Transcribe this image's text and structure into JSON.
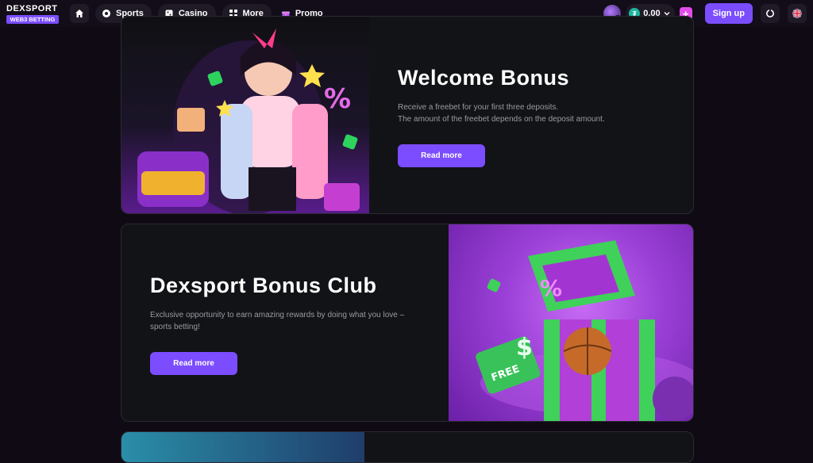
{
  "header": {
    "logo_brand": "DEXSPORT",
    "logo_tag": "WEB3 BETTING",
    "nav": [
      {
        "label": "Sports"
      },
      {
        "label": "Casino"
      },
      {
        "label": "More"
      },
      {
        "label": "Promo"
      }
    ],
    "balance": "0.00",
    "signup_label": "Sign up"
  },
  "promos": [
    {
      "title": "Welcome Bonus",
      "description_lines": [
        "Receive a freebet for your first three deposits.",
        "The amount of the freebet depends on the deposit amount."
      ],
      "button_label": "Read more"
    },
    {
      "title": "Dexsport Bonus Club",
      "description_lines": [
        "Exclusive opportunity to earn amazing rewards by doing what you love –",
        "sports betting!"
      ],
      "button_label": "Read more"
    }
  ],
  "icons": {
    "home": "home-icon",
    "sports": "soccer-ball-icon",
    "casino": "dice-icon",
    "more": "grid-icon",
    "promo": "gift-icon",
    "coin": "tether-coin-icon",
    "support": "support-icon",
    "language": "uk-flag-icon"
  },
  "colors": {
    "background": "#0f0a14",
    "accent": "#7b4dff",
    "plus": "#e14ce8",
    "card": "#121316"
  }
}
